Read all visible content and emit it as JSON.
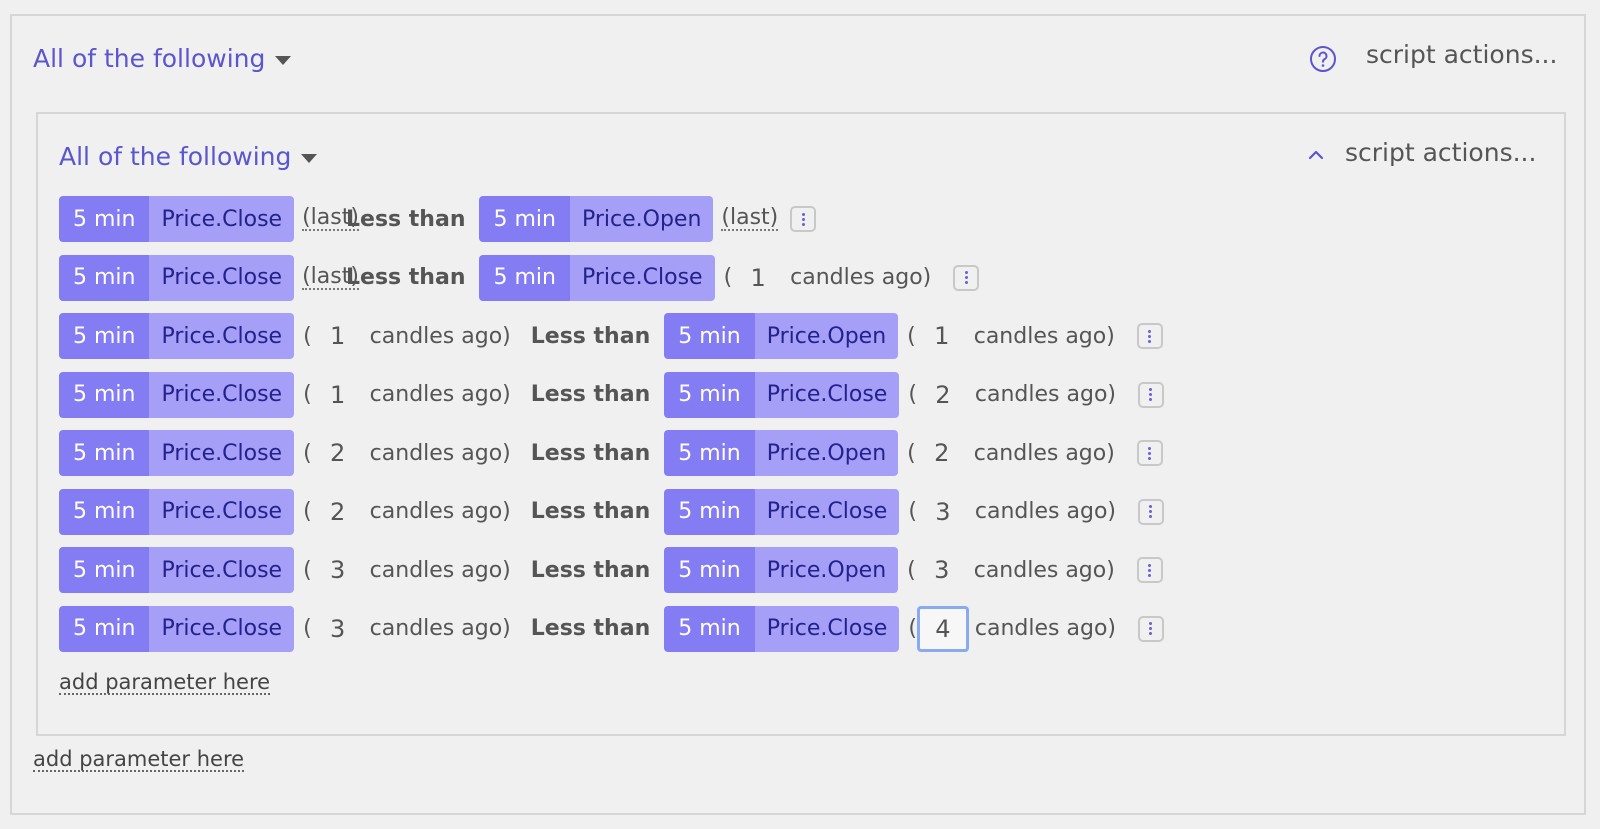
{
  "outer": {
    "group_label": "All of the following",
    "script_actions": "script actions...",
    "add_parameter": "add parameter here"
  },
  "inner": {
    "group_label": "All of the following",
    "script_actions": "script actions...",
    "add_parameter": "add parameter here"
  },
  "rows": [
    {
      "left": {
        "tf": "5 min",
        "sym": "Price.Close",
        "mode": "last",
        "last": "(last)"
      },
      "op": "Less than",
      "right": {
        "tf": "5 min",
        "sym": "Price.Open",
        "mode": "last",
        "last": "(last)"
      }
    },
    {
      "left": {
        "tf": "5 min",
        "sym": "Price.Close",
        "mode": "last",
        "last": "(last)"
      },
      "op": "Less than",
      "right": {
        "tf": "5 min",
        "sym": "Price.Close",
        "mode": "ago",
        "n": "1",
        "ago": "candles ago)"
      }
    },
    {
      "left": {
        "tf": "5 min",
        "sym": "Price.Close",
        "mode": "ago",
        "n": "1",
        "ago": "candles ago)"
      },
      "op": "Less than",
      "right": {
        "tf": "5 min",
        "sym": "Price.Open",
        "mode": "ago",
        "n": "1",
        "ago": "candles ago)"
      }
    },
    {
      "left": {
        "tf": "5 min",
        "sym": "Price.Close",
        "mode": "ago",
        "n": "1",
        "ago": "candles ago)"
      },
      "op": "Less than",
      "right": {
        "tf": "5 min",
        "sym": "Price.Close",
        "mode": "ago",
        "n": "2",
        "ago": "candles ago)"
      }
    },
    {
      "left": {
        "tf": "5 min",
        "sym": "Price.Close",
        "mode": "ago",
        "n": "2",
        "ago": "candles ago)"
      },
      "op": "Less than",
      "right": {
        "tf": "5 min",
        "sym": "Price.Open",
        "mode": "ago",
        "n": "2",
        "ago": "candles ago)"
      }
    },
    {
      "left": {
        "tf": "5 min",
        "sym": "Price.Close",
        "mode": "ago",
        "n": "2",
        "ago": "candles ago)"
      },
      "op": "Less than",
      "right": {
        "tf": "5 min",
        "sym": "Price.Close",
        "mode": "ago",
        "n": "3",
        "ago": "candles ago)"
      }
    },
    {
      "left": {
        "tf": "5 min",
        "sym": "Price.Close",
        "mode": "ago",
        "n": "3",
        "ago": "candles ago)"
      },
      "op": "Less than",
      "right": {
        "tf": "5 min",
        "sym": "Price.Open",
        "mode": "ago",
        "n": "3",
        "ago": "candles ago)"
      }
    },
    {
      "left": {
        "tf": "5 min",
        "sym": "Price.Close",
        "mode": "ago",
        "n": "3",
        "ago": "candles ago)"
      },
      "op": "Less than",
      "right": {
        "tf": "5 min",
        "sym": "Price.Close",
        "mode": "ago",
        "n": "4",
        "ago": "candles ago)",
        "active": true
      }
    }
  ],
  "colors": {
    "accent": "#5b55d0",
    "chip_timeframe": "#847cf3",
    "chip_symbol": "#a59ff8",
    "focus": "#8aaaf0"
  }
}
